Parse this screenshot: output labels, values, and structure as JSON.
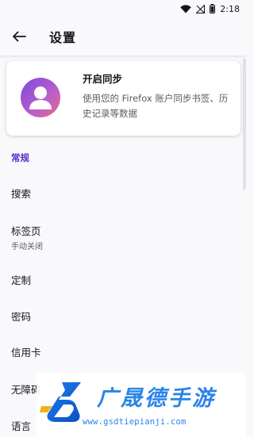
{
  "status_bar": {
    "time": "2:18",
    "icons": [
      "wifi-icon",
      "signal-off-icon",
      "battery-icon"
    ]
  },
  "header": {
    "title": "设置",
    "back_icon": "arrow-left-icon"
  },
  "sync_card": {
    "title": "开启同步",
    "description": "使用您的 Firefox 账户同步书签、历史记录等数据",
    "avatar_icon": "account-avatar-icon"
  },
  "section": {
    "label": "常规"
  },
  "menu": {
    "items": [
      {
        "label": "搜索"
      },
      {
        "label": "标签页",
        "sublabel": "手动关闭"
      },
      {
        "label": "定制"
      },
      {
        "label": "密码"
      },
      {
        "label": "信用卡"
      },
      {
        "label": "无障碍"
      },
      {
        "label": "语言"
      }
    ]
  },
  "watermark": {
    "title": "广晟德手游",
    "url": "www.gsdtiepianji.com"
  },
  "colors": {
    "accent": "#592acb",
    "background": "#f9f9fb",
    "watermark": "#2b84e8"
  }
}
